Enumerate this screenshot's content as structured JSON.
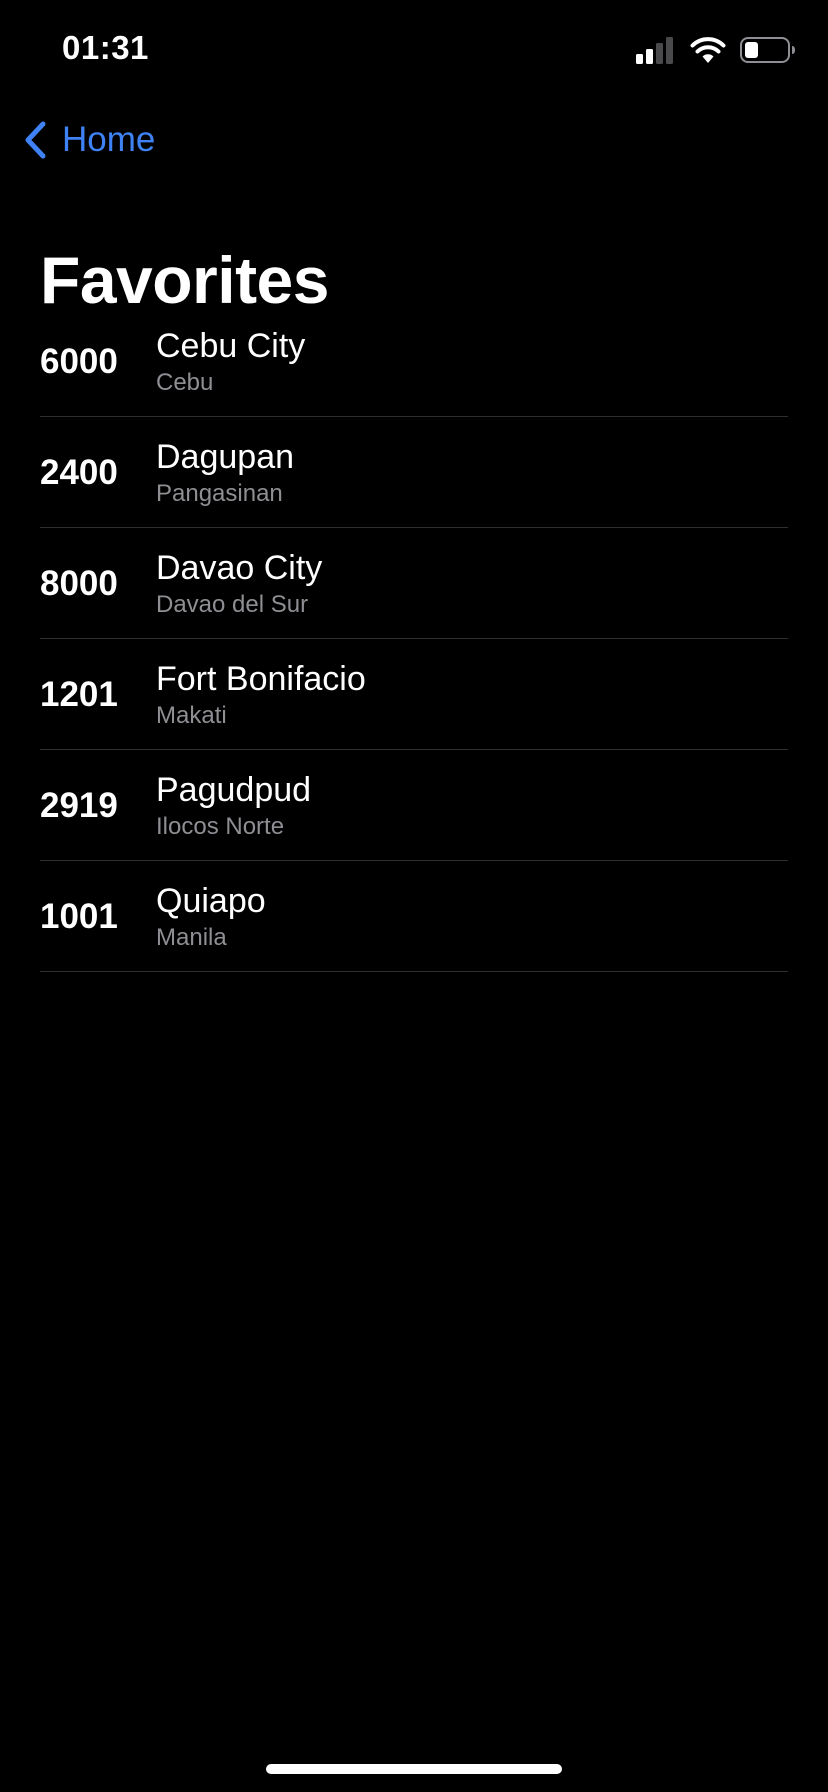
{
  "status_bar": {
    "time": "01:31",
    "icons": [
      "cellular-signal-icon",
      "wifi-icon",
      "battery-icon"
    ]
  },
  "nav": {
    "back_label": "Home",
    "back_icon": "chevron-left-icon",
    "accent_color": "#3f82f5"
  },
  "title": "Favorites",
  "favorites": [
    {
      "code": "6000",
      "name": "Cebu City",
      "region": "Cebu"
    },
    {
      "code": "2400",
      "name": "Dagupan",
      "region": "Pangasinan"
    },
    {
      "code": "8000",
      "name": "Davao City",
      "region": "Davao del Sur"
    },
    {
      "code": "1201",
      "name": "Fort Bonifacio",
      "region": "Makati"
    },
    {
      "code": "2919",
      "name": "Pagudpud",
      "region": "Ilocos Norte"
    },
    {
      "code": "1001",
      "name": "Quiapo",
      "region": "Manila"
    }
  ]
}
